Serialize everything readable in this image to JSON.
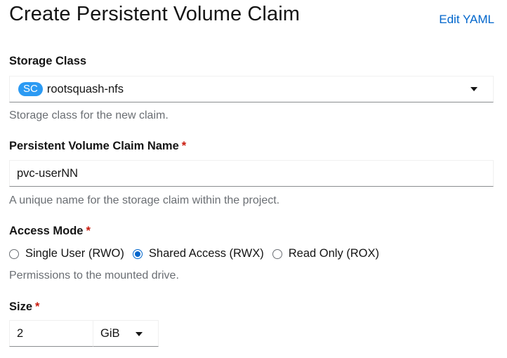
{
  "header": {
    "title": "Create Persistent Volume Claim",
    "edit_yaml_label": "Edit YAML"
  },
  "storage_class": {
    "label": "Storage Class",
    "badge": "SC",
    "value": "rootsquash-nfs",
    "helper": "Storage class for the new claim."
  },
  "claim_name": {
    "label": "Persistent Volume Claim Name",
    "required_mark": "*",
    "value": "pvc-userNN",
    "helper": "A unique name for the storage claim within the project."
  },
  "access_mode": {
    "label": "Access Mode",
    "required_mark": "*",
    "options": [
      {
        "label": "Single User (RWO)",
        "checked": false
      },
      {
        "label": "Shared Access (RWX)",
        "checked": true
      },
      {
        "label": "Read Only (ROX)",
        "checked": false
      }
    ],
    "helper": "Permissions to the mounted drive."
  },
  "size": {
    "label": "Size",
    "required_mark": "*",
    "value": "2",
    "unit": "GiB"
  },
  "colors": {
    "link": "#0066cc",
    "badge": "#2b9af3",
    "required": "#c9190b",
    "helper_text": "#6a6e73"
  }
}
